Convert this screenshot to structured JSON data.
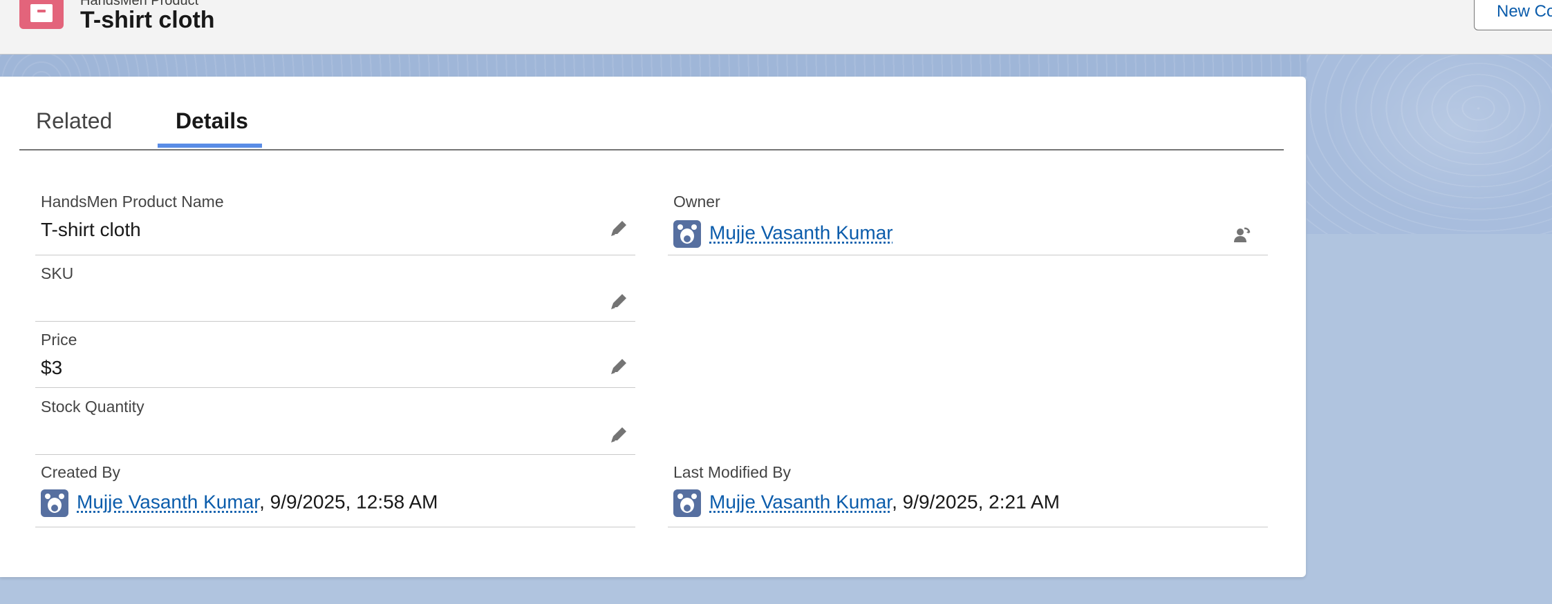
{
  "header": {
    "object_label": "HandsMen Product",
    "record_title": "T-shirt cloth",
    "new_button_label": "New Co",
    "icon": "product-box-icon"
  },
  "tabs": [
    {
      "label": "Related",
      "active": false
    },
    {
      "label": "Details",
      "active": true
    }
  ],
  "fields": {
    "product_name": {
      "label": "HandsMen Product Name",
      "value": "T-shirt cloth"
    },
    "sku": {
      "label": "SKU",
      "value": ""
    },
    "price": {
      "label": "Price",
      "value": "$3"
    },
    "stock_quantity": {
      "label": "Stock Quantity",
      "value": ""
    },
    "owner": {
      "label": "Owner",
      "user": "Mujje Vasanth Kumar"
    },
    "created_by": {
      "label": "Created By",
      "user": "Mujje Vasanth Kumar",
      "timestamp": ", 9/9/2025, 12:58 AM"
    },
    "last_modified_by": {
      "label": "Last Modified By",
      "user": "Mujje Vasanth Kumar",
      "timestamp": ", 9/9/2025, 2:21 AM"
    }
  },
  "colors": {
    "accent": "#5a8de6",
    "link": "#0b5cab",
    "icon_bg": "#e3647b",
    "avatar_bg": "#566fa0"
  }
}
